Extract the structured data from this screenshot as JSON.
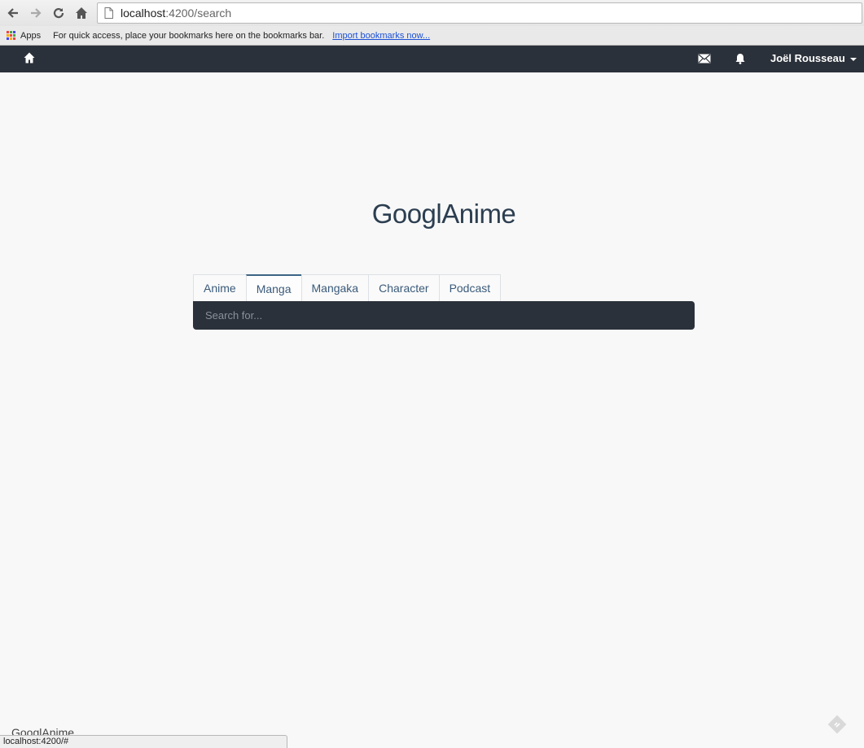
{
  "browser": {
    "url_host": "localhost",
    "url_path": ":4200/search"
  },
  "bookmarks": {
    "apps_label": "Apps",
    "hint_text": "For quick access, place your bookmarks here on the bookmarks bar.",
    "import_link": "Import bookmarks now..."
  },
  "navbar": {
    "user_name": "Joël Rousseau"
  },
  "main": {
    "title": "GooglAnime",
    "tabs": [
      {
        "label": "Anime",
        "active": false
      },
      {
        "label": "Manga",
        "active": true
      },
      {
        "label": "Mangaka",
        "active": false
      },
      {
        "label": "Character",
        "active": false
      },
      {
        "label": "Podcast",
        "active": false
      }
    ],
    "search_placeholder": "Search for..."
  },
  "footer": {
    "brand": "GooglAnime"
  },
  "status_bar": {
    "text": "localhost:4200/#"
  },
  "colors": {
    "navbar_bg": "#2b313a",
    "search_bg": "#2b313b",
    "title_color": "#2c3e50",
    "tab_text": "#3a5a7a"
  }
}
